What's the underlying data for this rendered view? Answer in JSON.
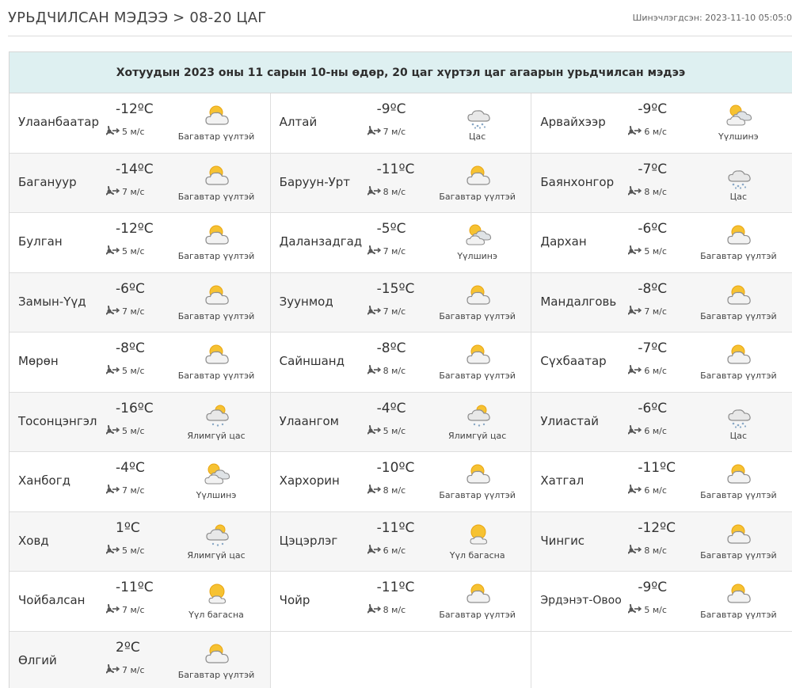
{
  "header": {
    "title": "УРЬДЧИЛСАН МЭДЭЭ > 08-20 ЦАГ",
    "updated": "Шинэчлэгдсэн: 2023-11-10 05:05:0"
  },
  "table": {
    "caption": "Хотуудын 2023 оны 11 сарын 10-ны өдөр, 20 цаг хүртэл цаг агаарын урьдчилсан мэдээ",
    "icons": {
      "partly-cloudy-icon": "Багавтар үүлтэй",
      "snow-icon": "Цас",
      "cloudy-icon": "Үүлшинэ",
      "light-snow-icon": "Ялимгүй цас",
      "mostly-sunny-icon": "Үүл багасна"
    },
    "rows": [
      [
        {
          "city": "Улаанбаатар",
          "temp": "-12ºC",
          "wind": "5 м/с",
          "cond": "Багавтар үүлтэй",
          "icon": "partly-cloudy-icon"
        },
        {
          "city": "Алтай",
          "temp": "-9ºC",
          "wind": "7 м/с",
          "cond": "Цас",
          "icon": "snow-icon"
        },
        {
          "city": "Арвайхээр",
          "temp": "-9ºC",
          "wind": "6 м/с",
          "cond": "Үүлшинэ",
          "icon": "cloudy-icon"
        }
      ],
      [
        {
          "city": "Багануур",
          "temp": "-14ºC",
          "wind": "7 м/с",
          "cond": "Багавтар үүлтэй",
          "icon": "partly-cloudy-icon"
        },
        {
          "city": "Баруун-Урт",
          "temp": "-11ºC",
          "wind": "8 м/с",
          "cond": "Багавтар үүлтэй",
          "icon": "partly-cloudy-icon"
        },
        {
          "city": "Баянхонгор",
          "temp": "-7ºC",
          "wind": "8 м/с",
          "cond": "Цас",
          "icon": "snow-icon"
        }
      ],
      [
        {
          "city": "Булган",
          "temp": "-12ºC",
          "wind": "5 м/с",
          "cond": "Багавтар үүлтэй",
          "icon": "partly-cloudy-icon"
        },
        {
          "city": "Даланзадгад",
          "temp": "-5ºC",
          "wind": "7 м/с",
          "cond": "Үүлшинэ",
          "icon": "cloudy-icon"
        },
        {
          "city": "Дархан",
          "temp": "-6ºC",
          "wind": "5 м/с",
          "cond": "Багавтар үүлтэй",
          "icon": "partly-cloudy-icon"
        }
      ],
      [
        {
          "city": "Замын-Үүд",
          "temp": "-6ºC",
          "wind": "7 м/с",
          "cond": "Багавтар үүлтэй",
          "icon": "partly-cloudy-icon"
        },
        {
          "city": "Зуунмод",
          "temp": "-15ºC",
          "wind": "7 м/с",
          "cond": "Багавтар үүлтэй",
          "icon": "partly-cloudy-icon"
        },
        {
          "city": "Мандалговь",
          "temp": "-8ºC",
          "wind": "7 м/с",
          "cond": "Багавтар үүлтэй",
          "icon": "partly-cloudy-icon"
        }
      ],
      [
        {
          "city": "Мөрөн",
          "temp": "-8ºC",
          "wind": "5 м/с",
          "cond": "Багавтар үүлтэй",
          "icon": "partly-cloudy-icon"
        },
        {
          "city": "Сайншанд",
          "temp": "-8ºC",
          "wind": "8 м/с",
          "cond": "Багавтар үүлтэй",
          "icon": "partly-cloudy-icon"
        },
        {
          "city": "Сүхбаатар",
          "temp": "-7ºC",
          "wind": "6 м/с",
          "cond": "Багавтар үүлтэй",
          "icon": "partly-cloudy-icon"
        }
      ],
      [
        {
          "city": "Тосонцэнгэл",
          "temp": "-16ºC",
          "wind": "5 м/с",
          "cond": "Ялимгүй цас",
          "icon": "light-snow-icon"
        },
        {
          "city": "Улаангом",
          "temp": "-4ºC",
          "wind": "5 м/с",
          "cond": "Ялимгүй цас",
          "icon": "light-snow-icon"
        },
        {
          "city": "Улиастай",
          "temp": "-6ºC",
          "wind": "6 м/с",
          "cond": "Цас",
          "icon": "snow-icon"
        }
      ],
      [
        {
          "city": "Ханбогд",
          "temp": "-4ºC",
          "wind": "7 м/с",
          "cond": "Үүлшинэ",
          "icon": "cloudy-icon"
        },
        {
          "city": "Хархорин",
          "temp": "-10ºC",
          "wind": "8 м/с",
          "cond": "Багавтар үүлтэй",
          "icon": "partly-cloudy-icon"
        },
        {
          "city": "Хатгал",
          "temp": "-11ºC",
          "wind": "6 м/с",
          "cond": "Багавтар үүлтэй",
          "icon": "partly-cloudy-icon"
        }
      ],
      [
        {
          "city": "Ховд",
          "temp": "1ºC",
          "wind": "5 м/с",
          "cond": "Ялимгүй цас",
          "icon": "light-snow-icon"
        },
        {
          "city": "Цэцэрлэг",
          "temp": "-11ºC",
          "wind": "6 м/с",
          "cond": "Үүл багасна",
          "icon": "mostly-sunny-icon"
        },
        {
          "city": "Чингис",
          "temp": "-12ºC",
          "wind": "8 м/с",
          "cond": "Багавтар үүлтэй",
          "icon": "partly-cloudy-icon"
        }
      ],
      [
        {
          "city": "Чойбалсан",
          "temp": "-11ºC",
          "wind": "7 м/с",
          "cond": "Үүл багасна",
          "icon": "mostly-sunny-icon"
        },
        {
          "city": "Чойр",
          "temp": "-11ºC",
          "wind": "8 м/с",
          "cond": "Багавтар үүлтэй",
          "icon": "partly-cloudy-icon"
        },
        {
          "city": "Эрдэнэт-Овоо",
          "temp": "-9ºC",
          "wind": "5 м/с",
          "cond": "Багавтар үүлтэй",
          "icon": "partly-cloudy-icon"
        }
      ],
      [
        {
          "city": "Өлгий",
          "temp": "2ºC",
          "wind": "7 м/с",
          "cond": "Багавтар үүлтэй",
          "icon": "partly-cloudy-icon"
        }
      ]
    ]
  }
}
